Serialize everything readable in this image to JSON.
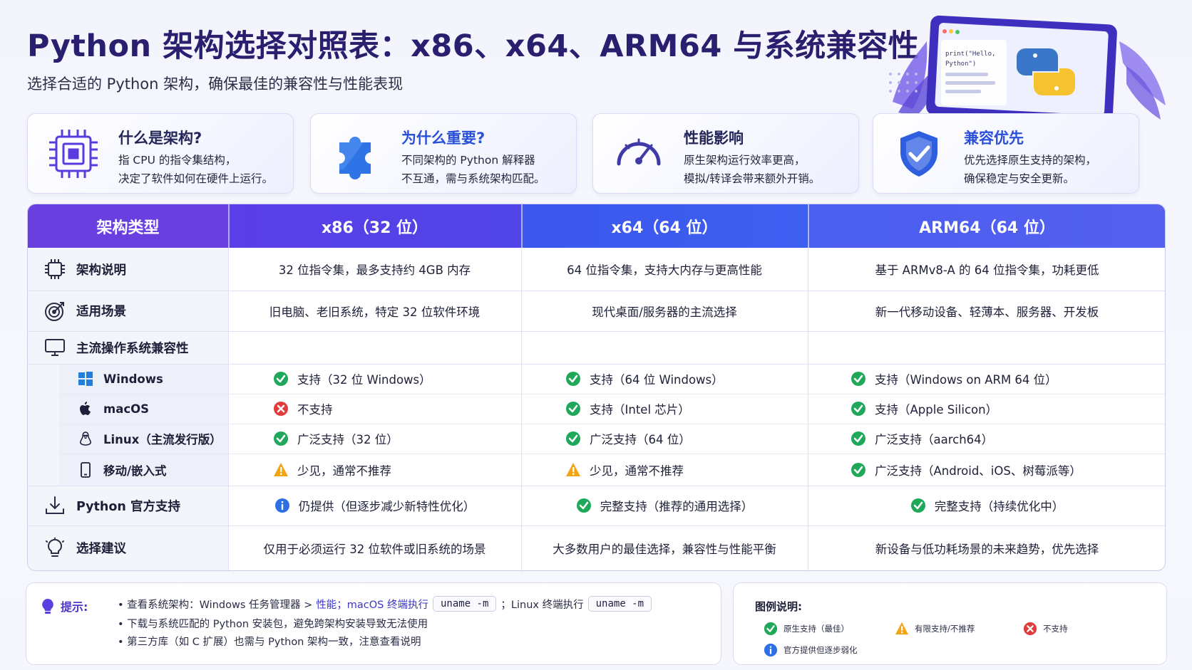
{
  "header": {
    "title": "Python 架构选择对照表：x86、x64、ARM64 与系统兼容性",
    "subtitle": "选择合适的 Python 架构，确保最佳的兼容性与性能表现"
  },
  "illustration": {
    "screen_text_1": "print(\"Hello,",
    "screen_text_2": "Python\")"
  },
  "cards": [
    {
      "title": "什么是架构?",
      "line1": "指 CPU 的指令集结构，",
      "line2": "决定了软件如何在硬件上运行。",
      "icon": "cpu-chip-icon"
    },
    {
      "title": "为什么重要?",
      "line1": "不同架构的 Python 解释器",
      "line2": "不互通，需与系统架构匹配。",
      "icon": "puzzle-piece-icon"
    },
    {
      "title": "性能影响",
      "line1": "原生架构运行效率更高，",
      "line2": "模拟/转译会带来额外开销。",
      "icon": "speedometer-icon"
    },
    {
      "title": "兼容优先",
      "line1": "优先选择原生支持的架构，",
      "line2": "确保稳定与安全更新。",
      "icon": "shield-check-icon"
    }
  ],
  "table": {
    "headers": [
      "架构类型",
      "x86（32 位）",
      "x64（64 位）",
      "ARM64（64 位）"
    ],
    "rows": {
      "arch_desc": {
        "label": "架构说明",
        "cells": [
          "32 位指令集，最多支持约 4GB 内存",
          "64 位指令集，支持大内存与更高性能",
          "基于 ARMv8-A 的 64 位指令集，功耗更低"
        ]
      },
      "scenario": {
        "label": "适用场景",
        "cells": [
          "旧电脑、老旧系统，特定 32 位软件环境",
          "现代桌面/服务器的主流选择",
          "新一代移动设备、轻薄本、服务器、开发板"
        ]
      },
      "os_compat": {
        "label": "主流操作系统兼容性"
      },
      "windows": {
        "label": "Windows",
        "cells": [
          "支持（32 位 Windows）",
          "支持（64 位 Windows）",
          "支持（Windows on ARM 64 位）"
        ],
        "status": [
          "ok",
          "ok",
          "ok"
        ]
      },
      "macos": {
        "label": "macOS",
        "cells": [
          "不支持",
          "支持（Intel 芯片）",
          "支持（Apple Silicon）"
        ],
        "status": [
          "no",
          "ok",
          "ok"
        ]
      },
      "linux": {
        "label": "Linux（主流发行版）",
        "cells": [
          "广泛支持（32 位）",
          "广泛支持（64 位）",
          "广泛支持（aarch64）"
        ],
        "status": [
          "ok",
          "ok",
          "ok"
        ]
      },
      "mobile": {
        "label": "移动/嵌入式",
        "cells": [
          "少见，通常不推荐",
          "少见，通常不推荐",
          "广泛支持（Android、iOS、树莓派等）"
        ],
        "status": [
          "warn",
          "warn",
          "ok"
        ]
      },
      "official": {
        "label": "Python 官方支持",
        "cells": [
          "仍提供（但逐步减少新特性优化）",
          "完整支持（推荐的通用选择）",
          "完整支持（持续优化中）"
        ],
        "status": [
          "info",
          "ok",
          "ok"
        ]
      },
      "advice": {
        "label": "选择建议",
        "cells": [
          "仅用于必须运行 32 位软件或旧系统的场景",
          "大多数用户的最佳选择，兼容性与性能平衡",
          "新设备与低功耗场景的未来趋势，优先选择"
        ]
      }
    }
  },
  "tips": {
    "label": "提示:",
    "l1_a": "• 查看系统架构：Windows 任务管理器 >",
    "l1_b": "性能；macOS 终端执行",
    "code1": "uname -m",
    "l1_c": "；Linux 终端执行",
    "code2": "uname -m",
    "l2": "• 下载与系统匹配的 Python 安装包，避免跨架构安装导致无法使用",
    "l3": "• 第三方库（如 C 扩展）也需与 Python 架构一致，注意查看说明"
  },
  "legend": {
    "title": "图例说明:",
    "ok": "原生支持（最佳）",
    "warn": "有限支持/不推荐",
    "no": "不支持",
    "info": "官方提供但逐步弱化"
  },
  "colors": {
    "ok": "#1fa85a",
    "warn": "#f2a413",
    "no": "#e23b3b",
    "info": "#2f6fe6",
    "header_purple": "#6a3fe0",
    "header_blue": "#3d5ff0"
  }
}
